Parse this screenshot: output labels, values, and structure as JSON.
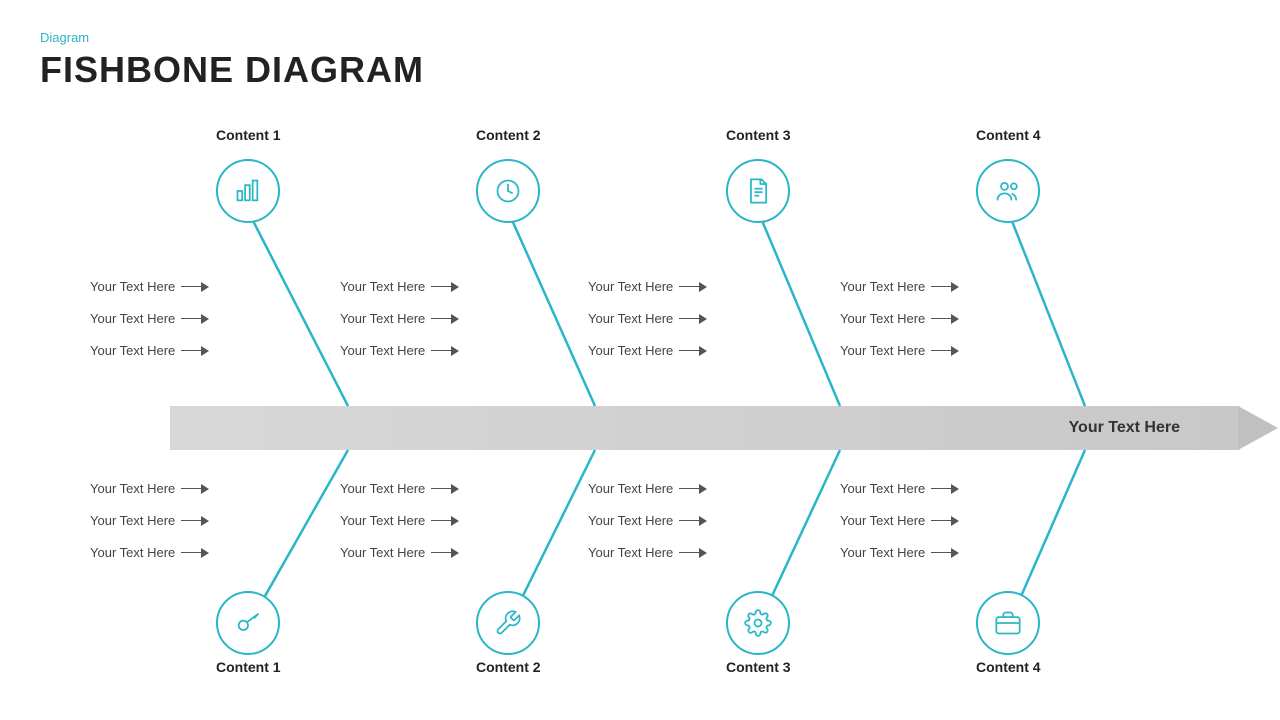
{
  "header": {
    "label": "Diagram",
    "title": "FISHBONE DIAGRAM"
  },
  "spine": {
    "text": "Your Text Here"
  },
  "top_sections": [
    {
      "id": "top1",
      "label": "Content 1",
      "icon": "bar-chart",
      "texts": [
        "Your Text Here",
        "Your Text Here",
        "Your Text Here"
      ]
    },
    {
      "id": "top2",
      "label": "Content 2",
      "icon": "clock",
      "texts": [
        "Your Text Here",
        "Your Text Here",
        "Your Text Here"
      ]
    },
    {
      "id": "top3",
      "label": "Content 3",
      "icon": "document",
      "texts": [
        "Your Text Here",
        "Your Text Here",
        "Your Text Here"
      ]
    },
    {
      "id": "top4",
      "label": "Content 4",
      "icon": "users",
      "texts": [
        "Your Text Here",
        "Your Text Here",
        "Your Text Here"
      ]
    }
  ],
  "bottom_sections": [
    {
      "id": "bot1",
      "label": "Content 1",
      "icon": "key",
      "texts": [
        "Your Text Here",
        "Your Text Here",
        "Your Text Here"
      ]
    },
    {
      "id": "bot2",
      "label": "Content 2",
      "icon": "wrench",
      "texts": [
        "Your Text Here",
        "Your Text Here",
        "Your Text Here"
      ]
    },
    {
      "id": "bot3",
      "label": "Content 3",
      "icon": "gear",
      "texts": [
        "Your Text Here",
        "Your Text Here",
        "Your Text Here"
      ]
    },
    {
      "id": "bot4",
      "label": "Content 4",
      "icon": "briefcase",
      "texts": [
        "Your Text Here",
        "Your Text Here",
        "Your Text Here"
      ]
    }
  ],
  "colors": {
    "accent": "#29b6c8",
    "text": "#444444",
    "spine_bg": "#d0d0d0"
  }
}
